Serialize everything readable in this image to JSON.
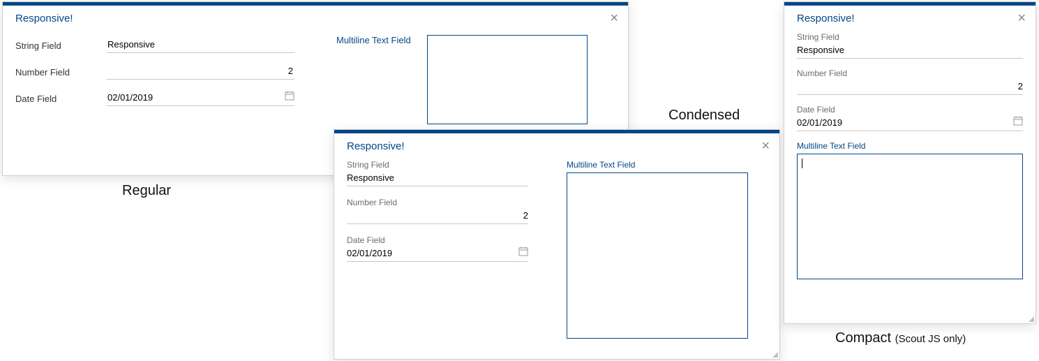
{
  "dialogTitle": "Responsive!",
  "fields": {
    "string": {
      "label": "String Field",
      "value": "Responsive"
    },
    "number": {
      "label": "Number Field",
      "value": "2"
    },
    "date": {
      "label": "Date Field",
      "value": "02/01/2019"
    },
    "multiline": {
      "label": "Multiline Text Field",
      "value": ""
    }
  },
  "captions": {
    "regular": "Regular",
    "condensed": "Condensed",
    "compact": "Compact",
    "compactNote": "(Scout JS only)"
  },
  "colors": {
    "brand": "#014786"
  }
}
